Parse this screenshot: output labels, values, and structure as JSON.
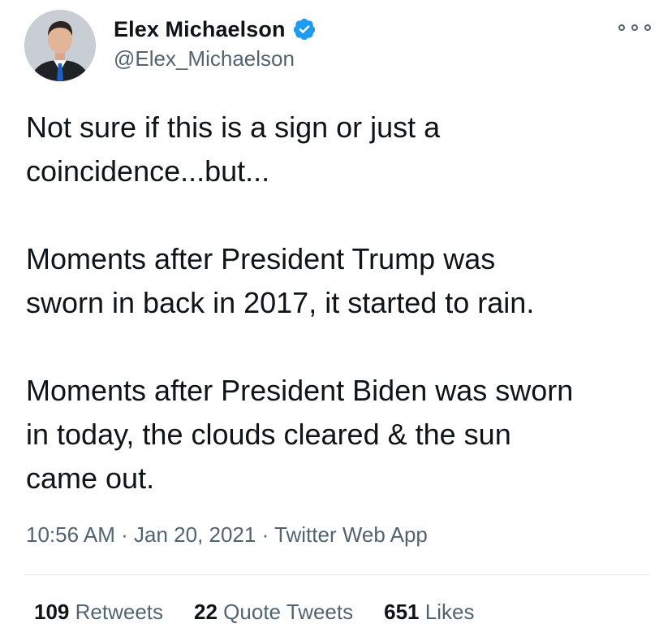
{
  "user": {
    "name": "Elex Michaelson",
    "handle": "@Elex_Michaelson",
    "verified_icon": "verified-badge-icon",
    "avatar": "avatar-photo"
  },
  "more_icon": "more-options-icon",
  "tweet": {
    "paragraphs": [
      "Not sure if this is a sign or just a\ncoincidence...but...",
      "Moments after President Trump was\nsworn in back in 2017, it started to rain.",
      "Moments after President Biden was sworn\nin today, the clouds cleared & the sun\ncame out."
    ],
    "time": "10:56 AM",
    "date": "Jan 20, 2021",
    "separator": "·",
    "source": "Twitter Web App"
  },
  "stats": {
    "retweets": {
      "count": "109",
      "label": "Retweets"
    },
    "quote_tweets": {
      "count": "22",
      "label": "Quote Tweets"
    },
    "likes": {
      "count": "651",
      "label": "Likes"
    }
  },
  "colors": {
    "text": "#0f1419",
    "secondary": "#536471",
    "verified_blue": "#1d9bf0",
    "divider": "#dfe3e6"
  }
}
